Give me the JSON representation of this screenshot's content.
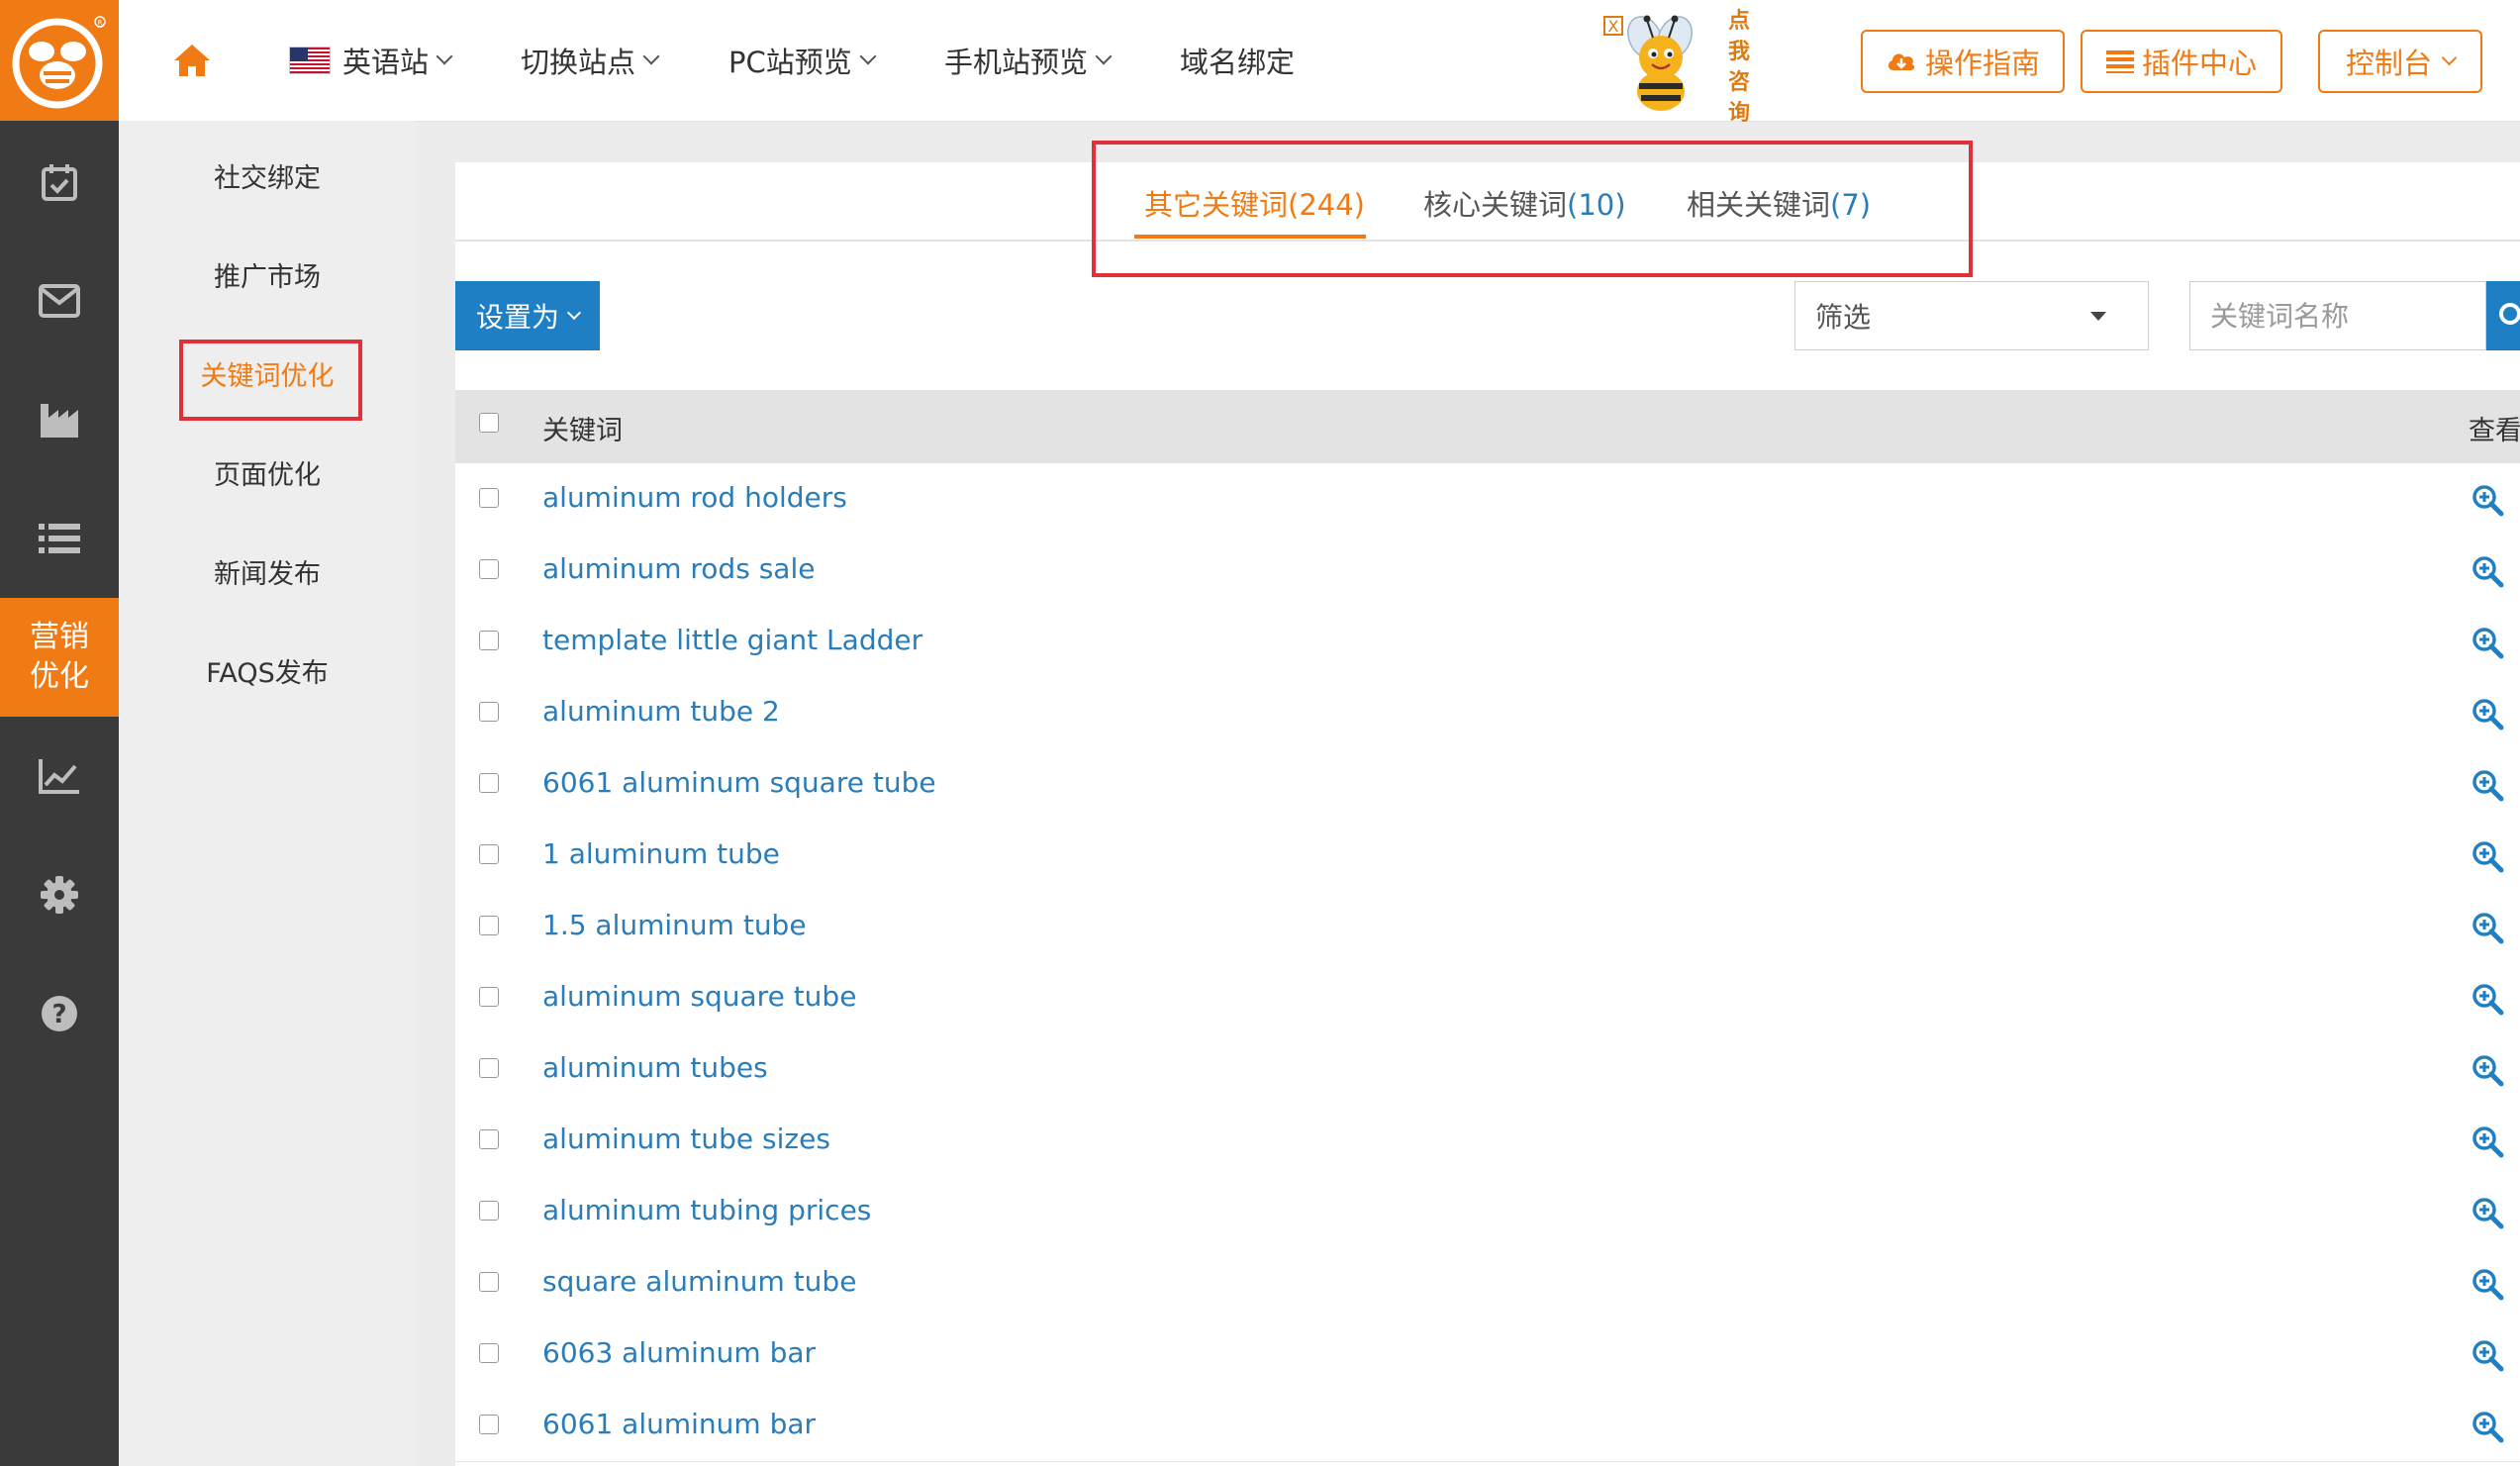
{
  "colors": {
    "accent": "#f07b14",
    "link": "#2a7db8",
    "primary_button": "#1e7fc4",
    "highlight_box": "#e0303a",
    "rail_bg": "#3a3a3a"
  },
  "rail": {
    "items": [
      {
        "icon": "calendar-check-icon"
      },
      {
        "icon": "envelope-icon"
      },
      {
        "icon": "factory-icon"
      },
      {
        "icon": "list-icon"
      },
      {
        "label_line1": "营销",
        "label_line2": "优化",
        "active": true
      },
      {
        "icon": "line-chart-icon"
      },
      {
        "icon": "gear-icon"
      },
      {
        "icon": "question-icon"
      }
    ]
  },
  "topnav": {
    "home_icon": "home-icon",
    "site": "英语站",
    "switch_site": "切换站点",
    "pc_preview": "PC站预览",
    "mobile_preview": "手机站预览",
    "domain_bind": "域名绑定"
  },
  "promo": {
    "text_chars": [
      "点",
      "我",
      "咨",
      "询"
    ],
    "close": "X"
  },
  "top_buttons": {
    "guide": "操作指南",
    "plugins": "插件中心",
    "console": "控制台"
  },
  "submenu": {
    "items": [
      "社交绑定",
      "推广市场",
      "关键词优化",
      "页面优化",
      "新闻发布",
      "FAQS发布"
    ],
    "active_index": 2
  },
  "tabs": [
    {
      "label": "其它关键词",
      "count": "(244)",
      "active": true
    },
    {
      "label": "核心关键词",
      "count": "(10)",
      "active": false
    },
    {
      "label": "相关关键词",
      "count": "(7)",
      "active": false
    }
  ],
  "toolbar": {
    "set_as": "设置为",
    "filter_value": "筛选",
    "keyword_placeholder": "关键词名称"
  },
  "table": {
    "headers": {
      "keyword": "关键词",
      "view": "查看"
    },
    "rows": [
      "aluminum rod holders",
      "aluminum rods sale",
      "template little giant Ladder",
      "aluminum tube 2",
      "6061 aluminum square tube",
      "1 aluminum tube",
      "1.5 aluminum tube",
      "aluminum square tube",
      "aluminum tubes",
      "aluminum tube sizes",
      "aluminum tubing prices",
      "square aluminum tube",
      "6063 aluminum bar",
      "6061 aluminum bar"
    ]
  }
}
